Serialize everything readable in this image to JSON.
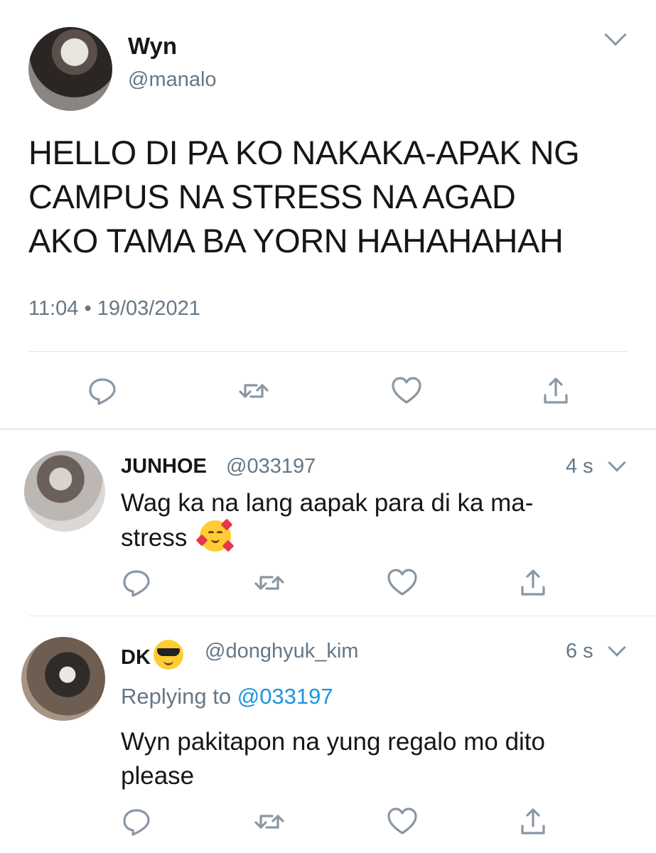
{
  "main_tweet": {
    "name": "Wyn",
    "handle": "@manalo",
    "text_lines": [
      "HELLO DI PA KO NAKAKA-APAK NG",
      "CAMPUS NA STRESS NA AGAD",
      "AKO TAMA BA YORN HAHAHAHAH"
    ],
    "time": "11:04",
    "separator": "•",
    "date": "19/03/2021"
  },
  "replies": [
    {
      "name": "JUNHOE",
      "handle": "@033197",
      "time": "4 s",
      "text_line1": "Wag ka na lang aapak para di ka ma-",
      "text_line2": "stress",
      "emoji_icon": "smiling-face-with-hearts-icon"
    },
    {
      "name": "DK",
      "name_emoji_icon": "sunglasses-face-icon",
      "handle": "@donghyuk_kim",
      "time": "6 s",
      "replying_prefix": "Replying to",
      "replying_mention": "@033197",
      "text_line1": "Wyn pakitapon na yung regalo mo dito",
      "text_line2": "please"
    }
  ],
  "icons": {
    "actions": [
      "reply-icon",
      "retweet-icon",
      "like-icon",
      "share-icon"
    ],
    "menu": "chevron-down-icon"
  },
  "colors": {
    "text": "#14171a",
    "secondary": "#657786",
    "icon": "#8a97a3",
    "link": "#1b95e0",
    "divider": "#e1e8ed"
  }
}
